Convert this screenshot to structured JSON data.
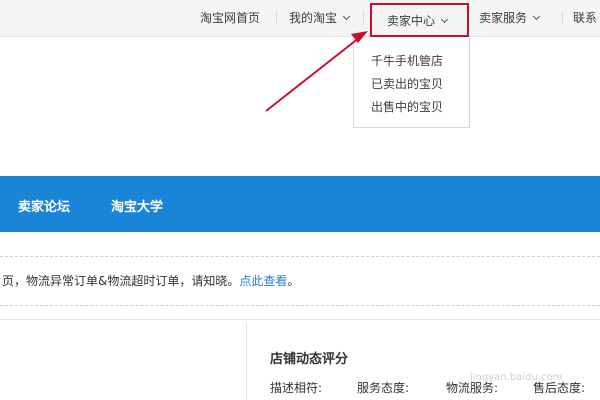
{
  "top_nav": {
    "home": "淘宝网首页",
    "my_taobao": "我的淘宝",
    "seller_center": "卖家中心",
    "seller_services": "卖家服务",
    "contact": "联系"
  },
  "seller_dropdown": {
    "items": [
      "千牛手机管店",
      "已卖出的宝贝",
      "出售中的宝贝"
    ]
  },
  "blue_nav": {
    "items": [
      "卖家论坛",
      "淘宝大学"
    ]
  },
  "notice": {
    "text": "页，物流异常订单&物流超时订单，请知晓。",
    "link": "点此查看",
    "end": "。"
  },
  "shop_rating": {
    "title": "店铺动态评分",
    "labels": [
      "描述相符:",
      "服务态度:",
      "物流服务:",
      "售后态度:"
    ]
  },
  "watermark": "jingyan.baidu.com",
  "colors": {
    "accent_blue": "#1a84d6",
    "highlight_red": "#c8102e",
    "link_blue": "#2a7dd2"
  }
}
